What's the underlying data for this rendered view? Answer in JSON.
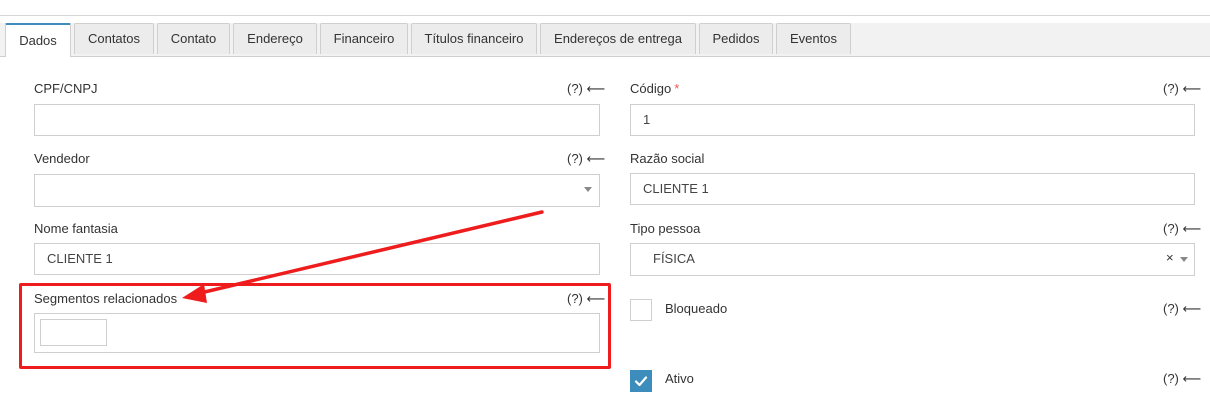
{
  "tabs": [
    {
      "label": "Dados",
      "active": true
    },
    {
      "label": "Contatos"
    },
    {
      "label": "Contato"
    },
    {
      "label": "Endereço"
    },
    {
      "label": "Financeiro"
    },
    {
      "label": "Títulos financeiro"
    },
    {
      "label": "Endereços de entrega"
    },
    {
      "label": "Pedidos"
    },
    {
      "label": "Eventos"
    }
  ],
  "help_text": "(?) ⟵",
  "left": {
    "cpf": {
      "label": "CPF/CNPJ",
      "value": ""
    },
    "vendedor": {
      "label": "Vendedor",
      "value": ""
    },
    "nome_fantasia": {
      "label": "Nome fantasia",
      "value": "CLIENTE 1"
    },
    "segmentos": {
      "label": "Segmentos relacionados"
    }
  },
  "right": {
    "codigo": {
      "label": "Código",
      "required_mark": "*",
      "value": "1"
    },
    "razao": {
      "label": "Razão social",
      "value": "CLIENTE 1"
    },
    "tipo": {
      "label": "Tipo pessoa",
      "value": "FÍSICA",
      "clear": "×"
    },
    "bloqueado": {
      "label": "Bloqueado",
      "checked": false
    },
    "ativo": {
      "label": "Ativo",
      "checked": true
    }
  },
  "colors": {
    "accent": "#3c8dbc",
    "annotation": "#ee1c1c",
    "required": "#e55555"
  }
}
